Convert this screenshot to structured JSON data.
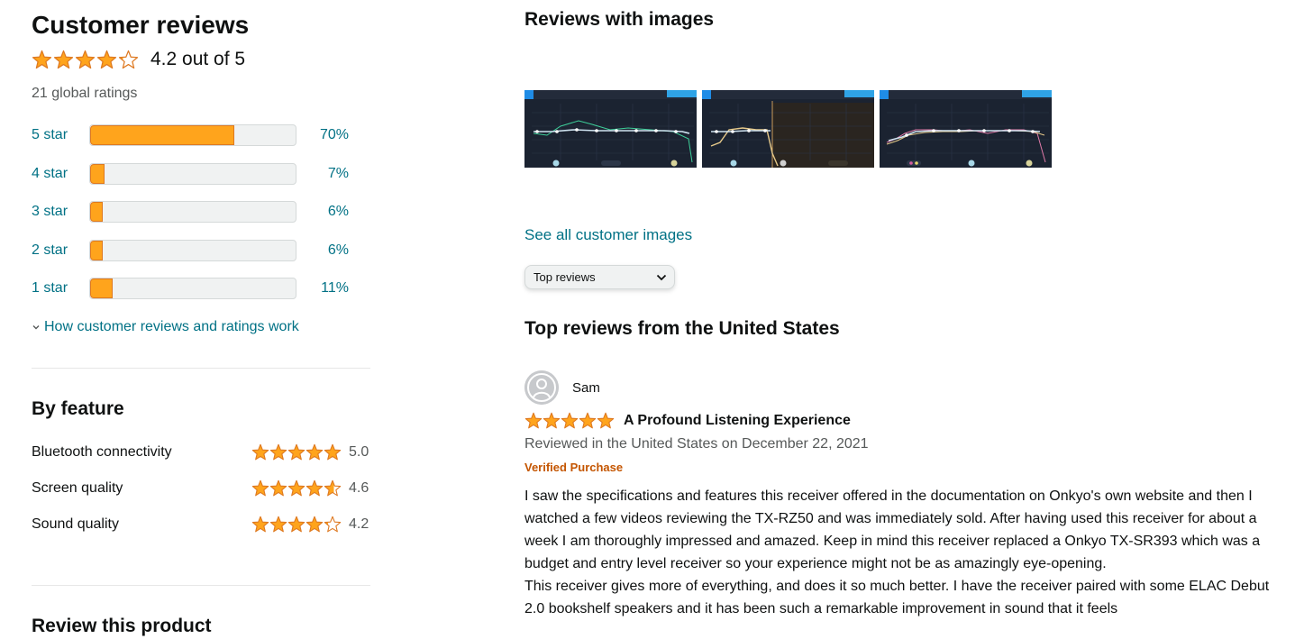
{
  "summary": {
    "title": "Customer reviews",
    "rating": 4.2,
    "rating_text": "4.2 out of 5",
    "global_ratings": "21 global ratings"
  },
  "histogram": [
    {
      "label": "5 star",
      "percent_text": "70%",
      "percent": 70
    },
    {
      "label": "4 star",
      "percent_text": "7%",
      "percent": 7
    },
    {
      "label": "3 star",
      "percent_text": "6%",
      "percent": 6
    },
    {
      "label": "2 star",
      "percent_text": "6%",
      "percent": 6
    },
    {
      "label": "1 star",
      "percent_text": "11%",
      "percent": 11
    }
  ],
  "how_link": "How customer reviews and ratings work",
  "by_feature": {
    "title": "By feature",
    "items": [
      {
        "name": "Bluetooth connectivity",
        "value": "5.0",
        "rating": 5.0
      },
      {
        "name": "Screen quality",
        "value": "4.6",
        "rating": 4.6
      },
      {
        "name": "Sound quality",
        "value": "4.2",
        "rating": 4.2
      }
    ]
  },
  "review_this": {
    "title": "Review this product"
  },
  "images_section": {
    "title": "Reviews with images",
    "see_all": "See all customer images",
    "thumbnails": [
      "eq-curve-screenshot-1",
      "eq-curve-screenshot-2",
      "eq-curve-screenshot-3"
    ]
  },
  "sort": {
    "selected": "Top reviews"
  },
  "top_reviews": {
    "title": "Top reviews from the United States",
    "reviews": [
      {
        "author": "Sam",
        "rating": 5,
        "title": "A Profound Listening Experience",
        "date": "Reviewed in the United States on December 22, 2021",
        "verified": "Verified Purchase",
        "body_p1": "I saw the specifications and features this receiver offered in the documentation on Onkyo's own website and then I watched a few videos reviewing the TX-RZ50 and was immediately sold. After having used this receiver for about a week I am thoroughly impressed and amazed. Keep in mind this receiver replaced a Onkyo TX-SR393 which was a budget and entry level receiver so your experience might not be as amazingly eye-opening.",
        "body_p2": "This receiver gives more of everything, and does it so much better. I have the receiver paired with some ELAC Debut 2.0 bookshelf speakers and it has been such a remarkable improvement in sound that it feels"
      }
    ]
  },
  "colors": {
    "star": "#ffa41c",
    "star_stroke": "#de7921",
    "link": "#007185",
    "verified": "#c45500",
    "muted": "#565959"
  }
}
